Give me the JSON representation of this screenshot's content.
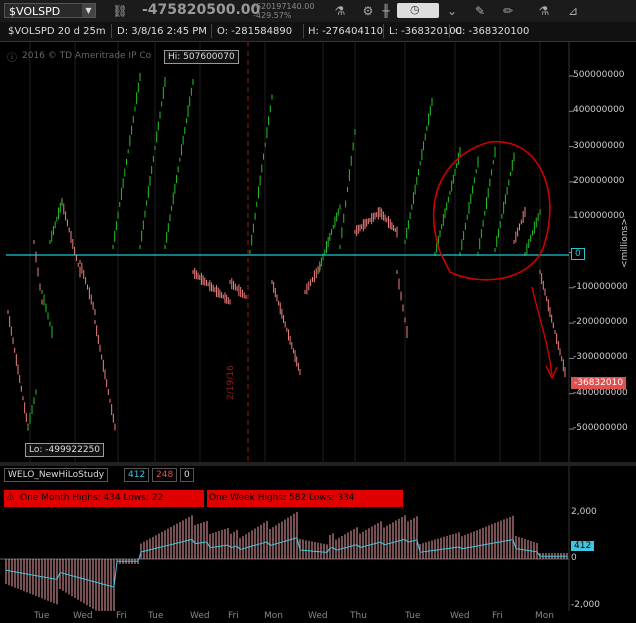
{
  "toolbar": {
    "symbol": "$VOLSPD",
    "last_price": "-475820500.00",
    "net_change": "-620197140.00",
    "pct_change": "-429.57%"
  },
  "infobar": {
    "symbol_period": "$VOLSPD 20 d 25m",
    "date": "D: 3/8/16 2:45 PM",
    "open": "O: -281584890",
    "high": "H: -276404110",
    "low": "L: -368320100",
    "close": "C: -368320100"
  },
  "upper_panel": {
    "copyright": "2016 © TD Ameritrade IP Co",
    "hi_label": "Hi: 507600070",
    "lo_label": "Lo: -499922250",
    "date_marker": "2/19/16",
    "axis_unit": "<millions>",
    "y_ticks": [
      "500000000",
      "400000000",
      "300000000",
      "200000000",
      "100000000",
      "0",
      "-100000000",
      "-200000000",
      "-300000000",
      "-400000000",
      "-500000000"
    ],
    "current_value": "-36832010",
    "zero_label": "0"
  },
  "lower_panel": {
    "study_name": "WELO_NewHiLoStudy",
    "val1": "412",
    "val2": "248",
    "val3": "0",
    "month_banner": "One Month Highs: 434 Lows: 22",
    "week_banner": "One Week Highs: 582 Lows: 334",
    "y_ticks": [
      "2,000",
      "0",
      "-2,000"
    ],
    "current_value": "412"
  },
  "x_axis": {
    "days": [
      "Tue",
      "Wed",
      "Fri",
      "Tue",
      "Wed",
      "Fri",
      "Mon",
      "Wed",
      "Thu",
      "Tue",
      "Wed",
      "Fri",
      "Mon"
    ]
  },
  "colors": {
    "up": "#22c322",
    "down": "#f08080",
    "zero_line": "#20c8d0",
    "annot": "#d00000"
  }
}
